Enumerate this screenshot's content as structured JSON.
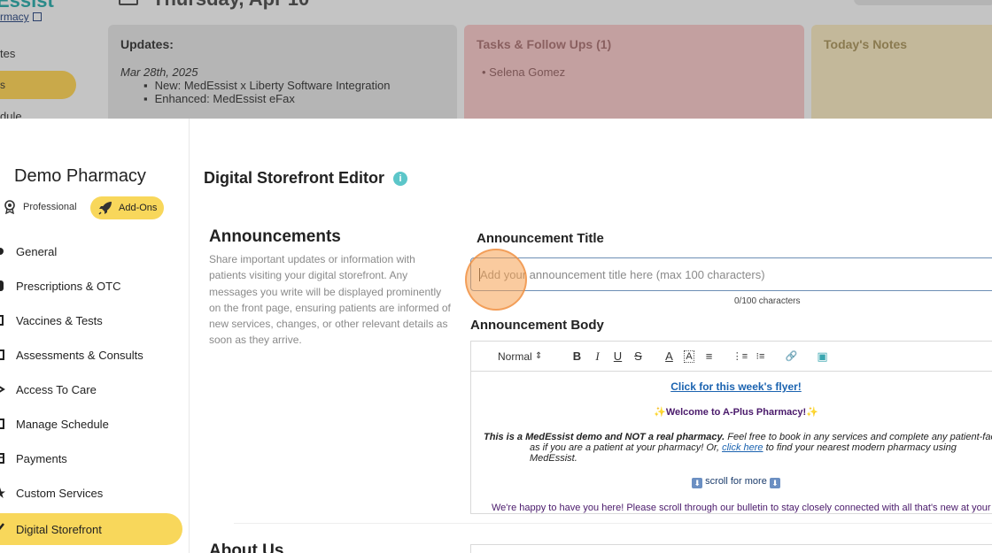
{
  "background": {
    "brand": "Essist",
    "pharmacy_link": "rmacy",
    "nav_item_1": "tes",
    "pill_label": "s",
    "nav_item_2": "dule",
    "date": "Thursday, Apr 10",
    "arrows": "‹   ›",
    "updates": {
      "title": "Updates:",
      "date": "Mar 28th, 2025",
      "items": [
        "New: MedEssist x Liberty Software Integration",
        "Enhanced: MedEssist eFax"
      ]
    },
    "tasks": {
      "title": "Tasks & Follow Ups (1)",
      "items": [
        "Selena Gomez"
      ]
    },
    "notes": {
      "title": "Today's Notes"
    }
  },
  "sidebar": {
    "pharmacy_name": "Demo Pharmacy",
    "tier_label": "Professional",
    "addons_label": "Add-Ons",
    "items": [
      {
        "label": "General",
        "icon": "gear-icon"
      },
      {
        "label": "Prescriptions & OTC",
        "icon": "pill-icon"
      },
      {
        "label": "Vaccines & Tests",
        "icon": "syringe-icon"
      },
      {
        "label": "Assessments & Consults",
        "icon": "stethoscope-icon"
      },
      {
        "label": "Access To Care",
        "icon": "key-icon"
      },
      {
        "label": "Manage Schedule",
        "icon": "calendar-icon"
      },
      {
        "label": "Payments",
        "icon": "card-icon"
      },
      {
        "label": "Custom Services",
        "icon": "star-icon"
      },
      {
        "label": "Digital Storefront",
        "icon": "pencil-icon",
        "active": true
      }
    ]
  },
  "editor": {
    "title": "Digital Storefront Editor",
    "info_glyph": "i",
    "announcements": {
      "heading": "Announcements",
      "description": "Share important updates or information with patients visiting your digital storefront. Any messages you write will be displayed prominently on the front page, ensuring patients are informed of new services, changes, or other relevant details as soon as they arrive.",
      "title_label": "Announcement Title",
      "title_placeholder": "Add your announcement title here (max 100 characters)",
      "title_value": "",
      "char_count": "0/100 characters",
      "body_label": "Announcement Body",
      "toolbar": {
        "format": "Normal",
        "format_caret": "⇕",
        "bold": "B",
        "italic": "I",
        "underline": "U",
        "strike": "S",
        "text_color": "A",
        "bg_color": "A",
        "align": "≡",
        "ordered_list": "⋮≡",
        "bullet_list": "⁝≡",
        "link": "🔗",
        "image": "▣"
      },
      "body": {
        "flyer_link": "Click for this week's flyer!",
        "welcome": "Welcome to A-Plus Pharmacy!",
        "sparkle": "✨",
        "demo_bold": "This is a MedEssist demo and NOT a real pharmacy.",
        "demo_rest": " Feel free to book in any services and complete any patient-facing",
        "demo_line2_a": "as if you are a patient at your pharmacy! Or, ",
        "demo_link": "click here",
        "demo_line2_b": " to find your nearest modern pharmacy using MedEssist.",
        "scroll_more": " scroll for more ",
        "down_arrow": "⬇",
        "happy": "We're happy to have you here! Please scroll through our bulletin to stay closely connected with all that's new at your trust"
      }
    },
    "about": {
      "heading": "About Us"
    }
  },
  "colors": {
    "accent_yellow": "#f8d75b",
    "info_teal": "#5cc6c9",
    "link_blue": "#1b63b0",
    "highlight_orange": "#f5a050"
  }
}
